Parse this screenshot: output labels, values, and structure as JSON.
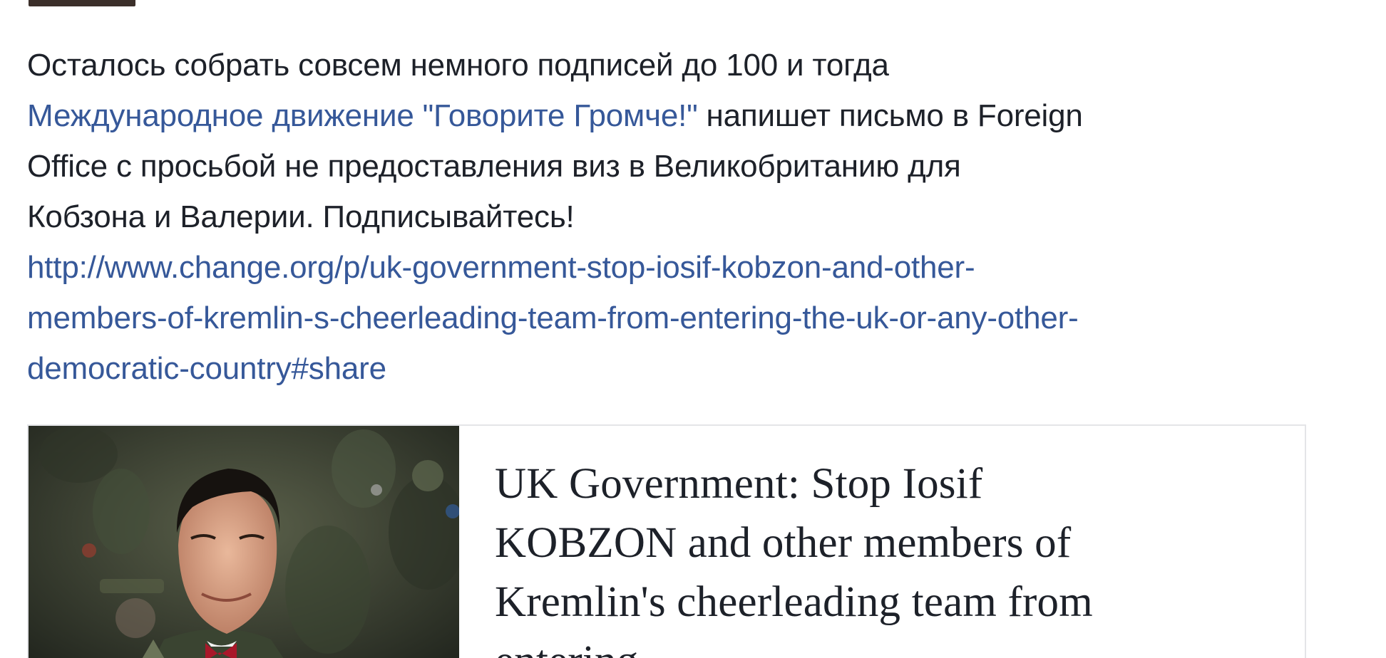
{
  "post": {
    "text_line1": "Осталось собрать совсем немного подписей до 100 и тогда",
    "mention": "Международное движение \"Говорите Громче!\"",
    "text_line2_rest": " напишет письмо в Foreign",
    "text_line3": "Office с просьбой не предоставления виз в Великобританию для",
    "text_line4": "Кобзона и Валерии. Подписывайтесь!",
    "url_line1": "http://www.change.org/p/uk-government-stop-iosif-kobzon-and-other-",
    "url_line2": "members-of-kremlin-s-cheerleading-team-from-entering-the-uk-or-any-other-",
    "url_line3": "democratic-country#share"
  },
  "link_preview": {
    "title_line1": "UK Government: Stop Iosif",
    "title_line2": "KOBZON and other members of",
    "title_line3": "Kremlin's cheerleading team from",
    "title_line4": "entering..."
  },
  "colors": {
    "link": "#365899",
    "text": "#1d2129",
    "card_border": "#e4e5e8"
  }
}
